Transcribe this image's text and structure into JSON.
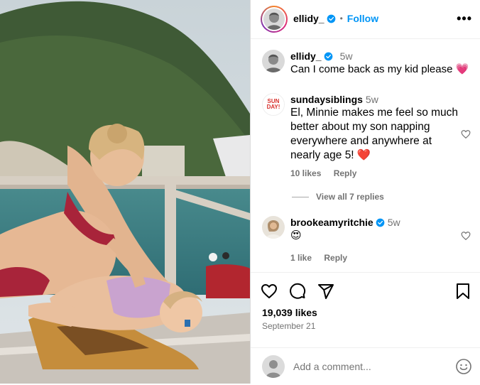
{
  "post": {
    "username": "ellidy_",
    "follow_label": "Follow",
    "dot": "•",
    "more_label": "•••"
  },
  "caption": {
    "username": "ellidy_",
    "time": "5w",
    "text": "Can I come back as my kid please 💗"
  },
  "comments": [
    {
      "username": "sundaysiblings",
      "time": "5w",
      "text": "El, Minnie makes me feel so much better about my son napping everywhere and anywhere at nearly age 5! ❤️",
      "likes": "10 likes",
      "reply": "Reply",
      "avatar_text": "SUN DAY!"
    },
    {
      "username": "brookeamyritchie",
      "time": "5w",
      "text": "😍",
      "likes": "1 like",
      "reply": "Reply"
    }
  ],
  "view_replies": "View all 7 replies",
  "stats": {
    "likes": "19,039 likes",
    "date": "September 21"
  },
  "add_comment": {
    "placeholder": "Add a comment..."
  },
  "colors": {
    "accent": "#0095f6",
    "verified": "#0095f6",
    "muted": "#737373"
  }
}
